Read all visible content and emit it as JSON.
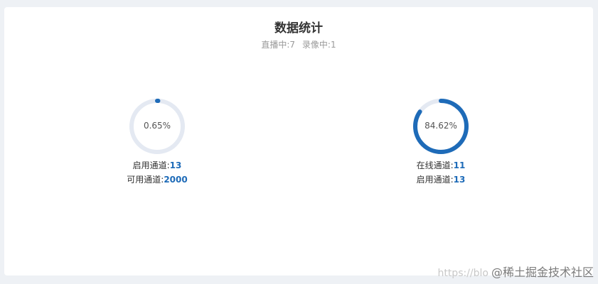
{
  "header": {
    "title": "数据统计",
    "live_label": "直播中:7",
    "record_label": "录像中:1"
  },
  "stats": [
    {
      "percent": 0.65,
      "percent_label": "0.65%",
      "line1_label": "启用通道:",
      "line1_value": "13",
      "line2_label": "可用通道:",
      "line2_value": "2000"
    },
    {
      "percent": 84.62,
      "percent_label": "84.62%",
      "line1_label": "在线通道:",
      "line1_value": "11",
      "line2_label": "启用通道:",
      "line2_value": "13"
    }
  ],
  "watermark": {
    "url_part": "https://blo",
    "brand": "@稀土掘金技术社区"
  },
  "colors": {
    "ring_track": "#e4e9f2",
    "ring_fill": "#1e6bb8",
    "value_text": "#1e6bb8"
  }
}
